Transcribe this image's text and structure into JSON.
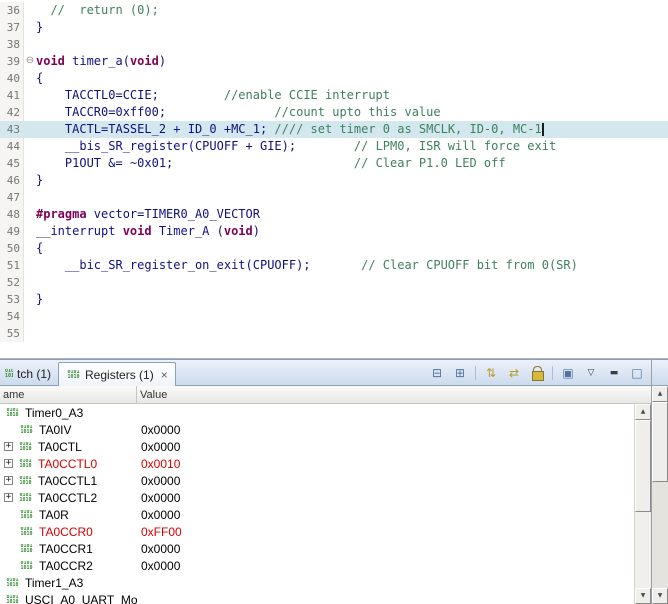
{
  "colors": {
    "comment": "#3f7f5f",
    "keyword": "#7f0055",
    "code_text": "#10107e",
    "changed_value": "#d40000",
    "line_highlight": "#d3e8ee",
    "icon_green": "#2e8b2e"
  },
  "icons": {
    "register_glyph": "0101\n1010",
    "fold_glyph": "⊖",
    "expand_glyph": "+",
    "close_glyph": "×",
    "arrow_up_glyph": "▲",
    "arrow_down_glyph": "▼"
  },
  "editor": {
    "lines": [
      {
        "num": "36",
        "segments": [
          {
            "style": "comment",
            "text": "  //  return (0);"
          }
        ]
      },
      {
        "num": "37",
        "segments": [
          {
            "style": "code",
            "text": "}"
          }
        ]
      },
      {
        "num": "38",
        "segments": []
      },
      {
        "num": "39",
        "fold": true,
        "segments": [
          {
            "style": "keyword",
            "text": "void"
          },
          {
            "style": "code",
            "text": " timer_a("
          },
          {
            "style": "keyword",
            "text": "void"
          },
          {
            "style": "code",
            "text": ")"
          }
        ]
      },
      {
        "num": "40",
        "segments": [
          {
            "style": "code",
            "text": "{"
          }
        ]
      },
      {
        "num": "41",
        "segments": [
          {
            "style": "code",
            "text": "    TACCTL0=CCIE;         "
          },
          {
            "style": "comment",
            "text": "//enable CCIE interrupt"
          }
        ]
      },
      {
        "num": "42",
        "segments": [
          {
            "style": "code",
            "text": "    TACCR0=0xff00;               "
          },
          {
            "style": "comment",
            "text": "//count upto this value"
          }
        ]
      },
      {
        "num": "43",
        "highlight": true,
        "cursor": true,
        "segments": [
          {
            "style": "code",
            "text": "    TACTL=TASSEL_2 + ID_0 +MC_1; "
          },
          {
            "style": "comment",
            "text": "//// set timer 0 as SMCLK, ID-0, MC-1"
          }
        ]
      },
      {
        "num": "44",
        "segments": [
          {
            "style": "code",
            "text": "    __bis_SR_register(CPUOFF + GIE);        "
          },
          {
            "style": "comment",
            "text": "// LPM0, ISR will force exit"
          }
        ]
      },
      {
        "num": "45",
        "segments": [
          {
            "style": "code",
            "text": "    P1OUT &= ~0x01;                         "
          },
          {
            "style": "comment",
            "text": "// Clear P1.0 LED off"
          }
        ]
      },
      {
        "num": "46",
        "segments": [
          {
            "style": "code",
            "text": "}"
          }
        ]
      },
      {
        "num": "47",
        "segments": []
      },
      {
        "num": "48",
        "segments": [
          {
            "style": "keyword",
            "text": "#pragma"
          },
          {
            "style": "code",
            "text": " vector=TIMER0_A0_VECTOR"
          }
        ]
      },
      {
        "num": "49",
        "segments": [
          {
            "style": "code",
            "text": "__interrupt "
          },
          {
            "style": "keyword",
            "text": "void"
          },
          {
            "style": "code",
            "text": " Timer_A ("
          },
          {
            "style": "keyword",
            "text": "void"
          },
          {
            "style": "code",
            "text": ")"
          }
        ]
      },
      {
        "num": "50",
        "segments": [
          {
            "style": "code",
            "text": "{"
          }
        ]
      },
      {
        "num": "51",
        "segments": [
          {
            "style": "code",
            "text": "    __bic_SR_register_on_exit(CPUOFF);       "
          },
          {
            "style": "comment",
            "text": "// Clear CPUOFF bit from 0(SR)"
          }
        ]
      },
      {
        "num": "52",
        "segments": []
      },
      {
        "num": "53",
        "segments": [
          {
            "style": "code",
            "text": "}"
          }
        ]
      },
      {
        "num": "54",
        "segments": []
      },
      {
        "num": "55",
        "segments": []
      }
    ]
  },
  "registers": {
    "tabs": {
      "watch_label": "tch (1)",
      "registers_label": "Registers (1)"
    },
    "toolbar": [
      {
        "name": "layout-collapse-icon",
        "glyph": "⊟"
      },
      {
        "name": "layout-grid-icon",
        "glyph": "⊞"
      },
      {
        "sep": true
      },
      {
        "name": "refresh-registers-icon",
        "glyph": "⇅",
        "tone": "gold"
      },
      {
        "name": "write-registers-icon",
        "glyph": "⇄",
        "tone": "gold"
      },
      {
        "name": "lock-icon",
        "glyph": "",
        "tone": "lock"
      },
      {
        "sep": true
      },
      {
        "name": "new-register-group-icon",
        "glyph": "▣"
      },
      {
        "name": "view-menu-icon",
        "glyph": "▽",
        "tone": "small"
      },
      {
        "name": "minimize-icon",
        "glyph": "▬",
        "tone": "small"
      },
      {
        "name": "maximize-icon",
        "glyph": "□"
      }
    ],
    "columns": {
      "name": "ame",
      "value": "Value"
    },
    "rows": [
      {
        "name": "Timer0_A3",
        "value": "",
        "group": true
      },
      {
        "name": "TA0IV",
        "value": "0x0000"
      },
      {
        "name": "TA0CTL",
        "value": "0x0000",
        "expandable": true
      },
      {
        "name": "TA0CCTL0",
        "value": "0x0010",
        "expandable": true,
        "changed": true
      },
      {
        "name": "TA0CCTL1",
        "value": "0x0000",
        "expandable": true
      },
      {
        "name": "TA0CCTL2",
        "value": "0x0000",
        "expandable": true
      },
      {
        "name": "TA0R",
        "value": "0x0000"
      },
      {
        "name": "TA0CCR0",
        "value": "0xFF00",
        "changed": true
      },
      {
        "name": "TA0CCR1",
        "value": "0x0000"
      },
      {
        "name": "TA0CCR2",
        "value": "0x0000"
      },
      {
        "name": "Timer1_A3",
        "value": "",
        "group": true
      },
      {
        "name": "USCI_A0_UART_Mo",
        "value": "",
        "group": true
      }
    ]
  }
}
